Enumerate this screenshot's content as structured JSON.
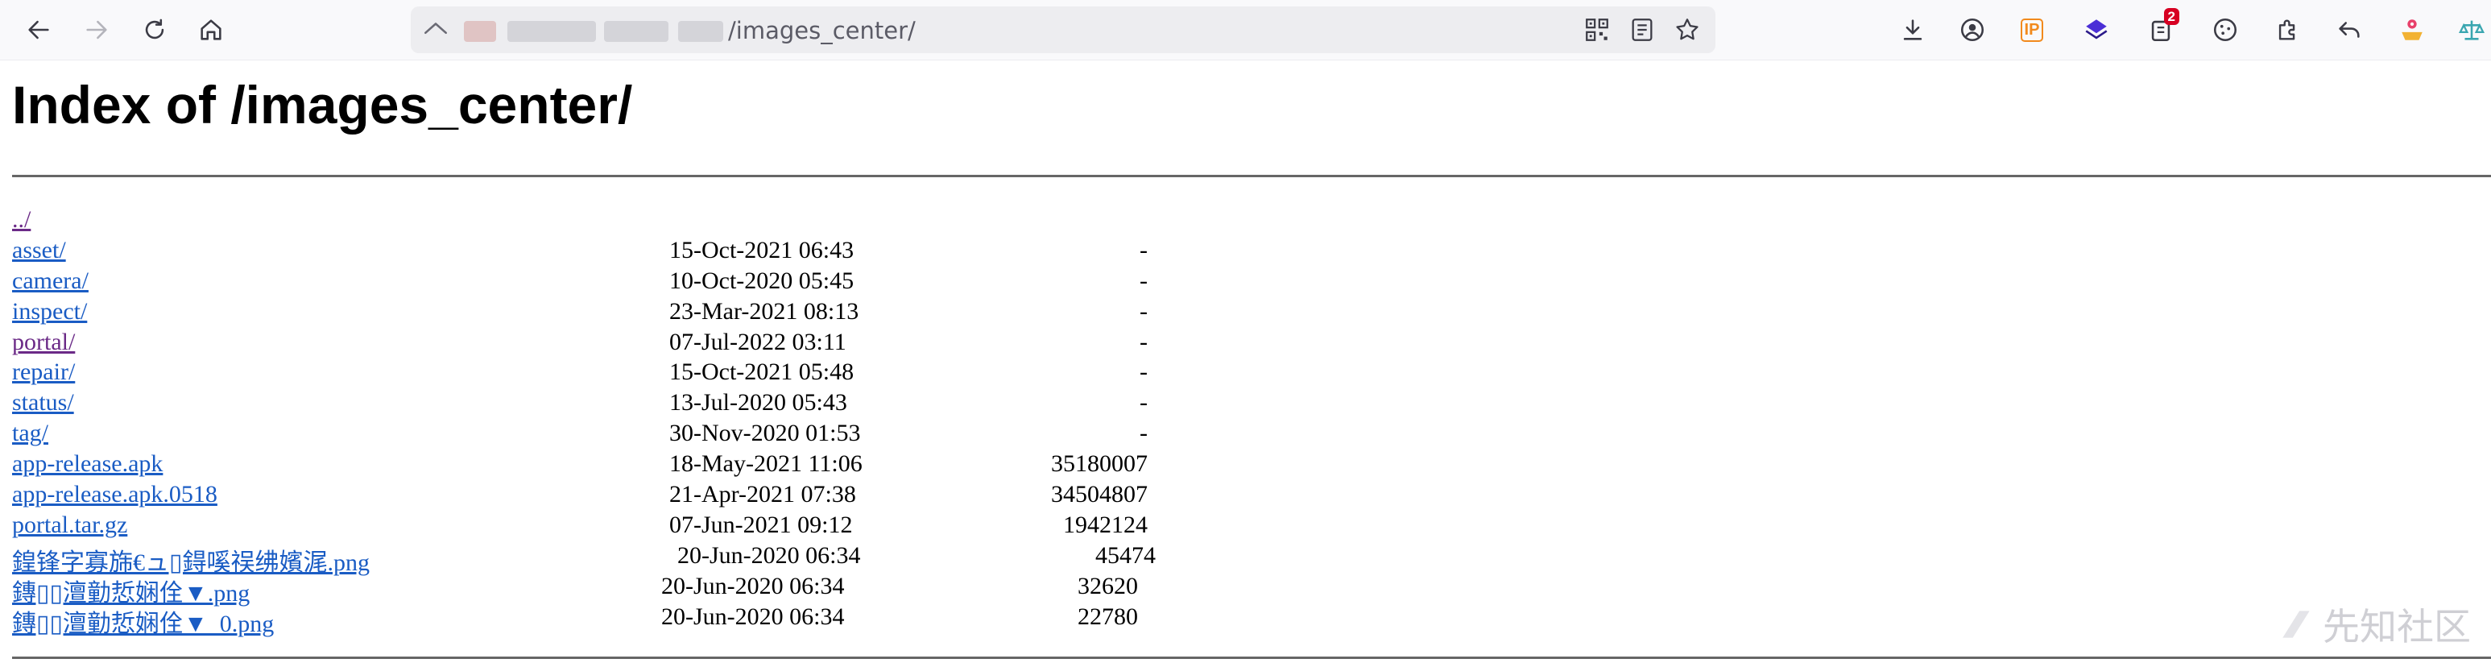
{
  "browser": {
    "url_path": "/images_center/",
    "extensions": {
      "ip_label": "IP",
      "notification_count": "2"
    }
  },
  "page": {
    "title": "Index of /images_center/",
    "parent_link": "../",
    "entries": [
      {
        "name": "asset/",
        "date": "15-Oct-2021 06:43",
        "size": "-"
      },
      {
        "name": "camera/",
        "date": "10-Oct-2020 05:45",
        "size": "-"
      },
      {
        "name": "inspect/",
        "date": "23-Mar-2021 08:13",
        "size": "-"
      },
      {
        "name": "portal/",
        "date": "07-Jul-2022 03:11",
        "size": "-"
      },
      {
        "name": "repair/",
        "date": "15-Oct-2021 05:48",
        "size": "-"
      },
      {
        "name": "status/",
        "date": "13-Jul-2020 05:43",
        "size": "-"
      },
      {
        "name": "tag/",
        "date": "30-Nov-2020 01:53",
        "size": "-"
      },
      {
        "name": "app-release.apk",
        "date": "18-May-2021 11:06",
        "size": "35180007"
      },
      {
        "name": "app-release.apk.0518",
        "date": "21-Apr-2021 07:38",
        "size": "34504807"
      },
      {
        "name": "portal.tar.gz",
        "date": "07-Jun-2021 09:12",
        "size": "1942124"
      },
      {
        "name": "鍠锋字寡旆€ュ▯鍀嗘祦绋嬪浘.png",
        "date": "20-Jun-2020 06:34",
        "size": "45474"
      },
      {
        "name": "鏄▯▯澶勭悊娴佺▼.png",
        "date": "20-Jun-2020 06:34",
        "size": "32620"
      },
      {
        "name": "鏄▯▯澶勭悊娴佺▼_0.png",
        "date": "20-Jun-2020 06:34",
        "size": "22780"
      }
    ]
  },
  "watermark": {
    "text": "先知社区"
  }
}
